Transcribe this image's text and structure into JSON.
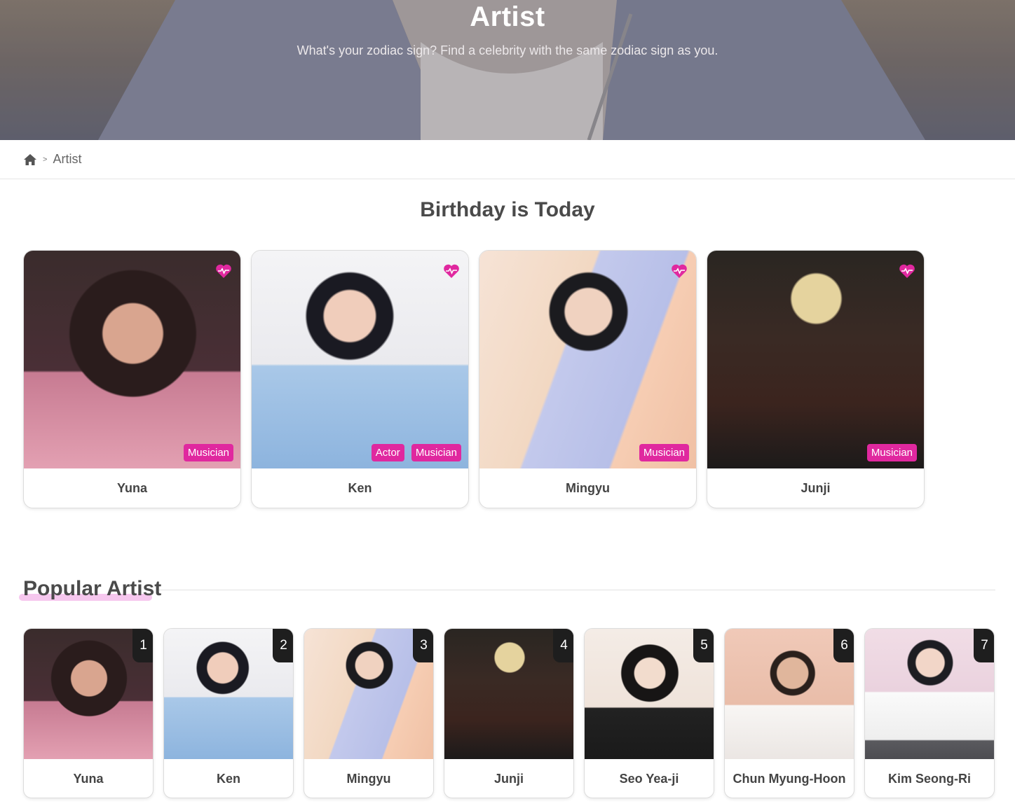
{
  "hero": {
    "title": "Artist",
    "subtitle": "What's your zodiac sign? Find a celebrity with the same zodiac sign as you."
  },
  "breadcrumb": {
    "home_icon": "home-icon",
    "separator": ">",
    "current": "Artist"
  },
  "birthday": {
    "title": "Birthday is Today",
    "cards": [
      {
        "name": "Yuna",
        "tags": [
          "Musician"
        ],
        "icon": "heart-pulse-icon"
      },
      {
        "name": "Ken",
        "tags": [
          "Actor",
          "Musician"
        ],
        "icon": "heart-pulse-icon"
      },
      {
        "name": "Mingyu",
        "tags": [
          "Musician"
        ],
        "icon": "heart-pulse-icon"
      },
      {
        "name": "Junji",
        "tags": [
          "Musician"
        ],
        "icon": "heart-pulse-icon"
      }
    ]
  },
  "popular": {
    "title": "Popular Artist",
    "cards": [
      {
        "rank": "1",
        "name": "Yuna"
      },
      {
        "rank": "2",
        "name": "Ken"
      },
      {
        "rank": "3",
        "name": "Mingyu"
      },
      {
        "rank": "4",
        "name": "Junji"
      },
      {
        "rank": "5",
        "name": "Seo Yea-ji"
      },
      {
        "rank": "6",
        "name": "Chun Myung-Hoon"
      },
      {
        "rank": "7",
        "name": "Kim Seong-Ri"
      }
    ]
  },
  "colors": {
    "accent": "#e0289f",
    "rank_badge": "#1e1e1e",
    "underline": "#f6c7ee"
  }
}
